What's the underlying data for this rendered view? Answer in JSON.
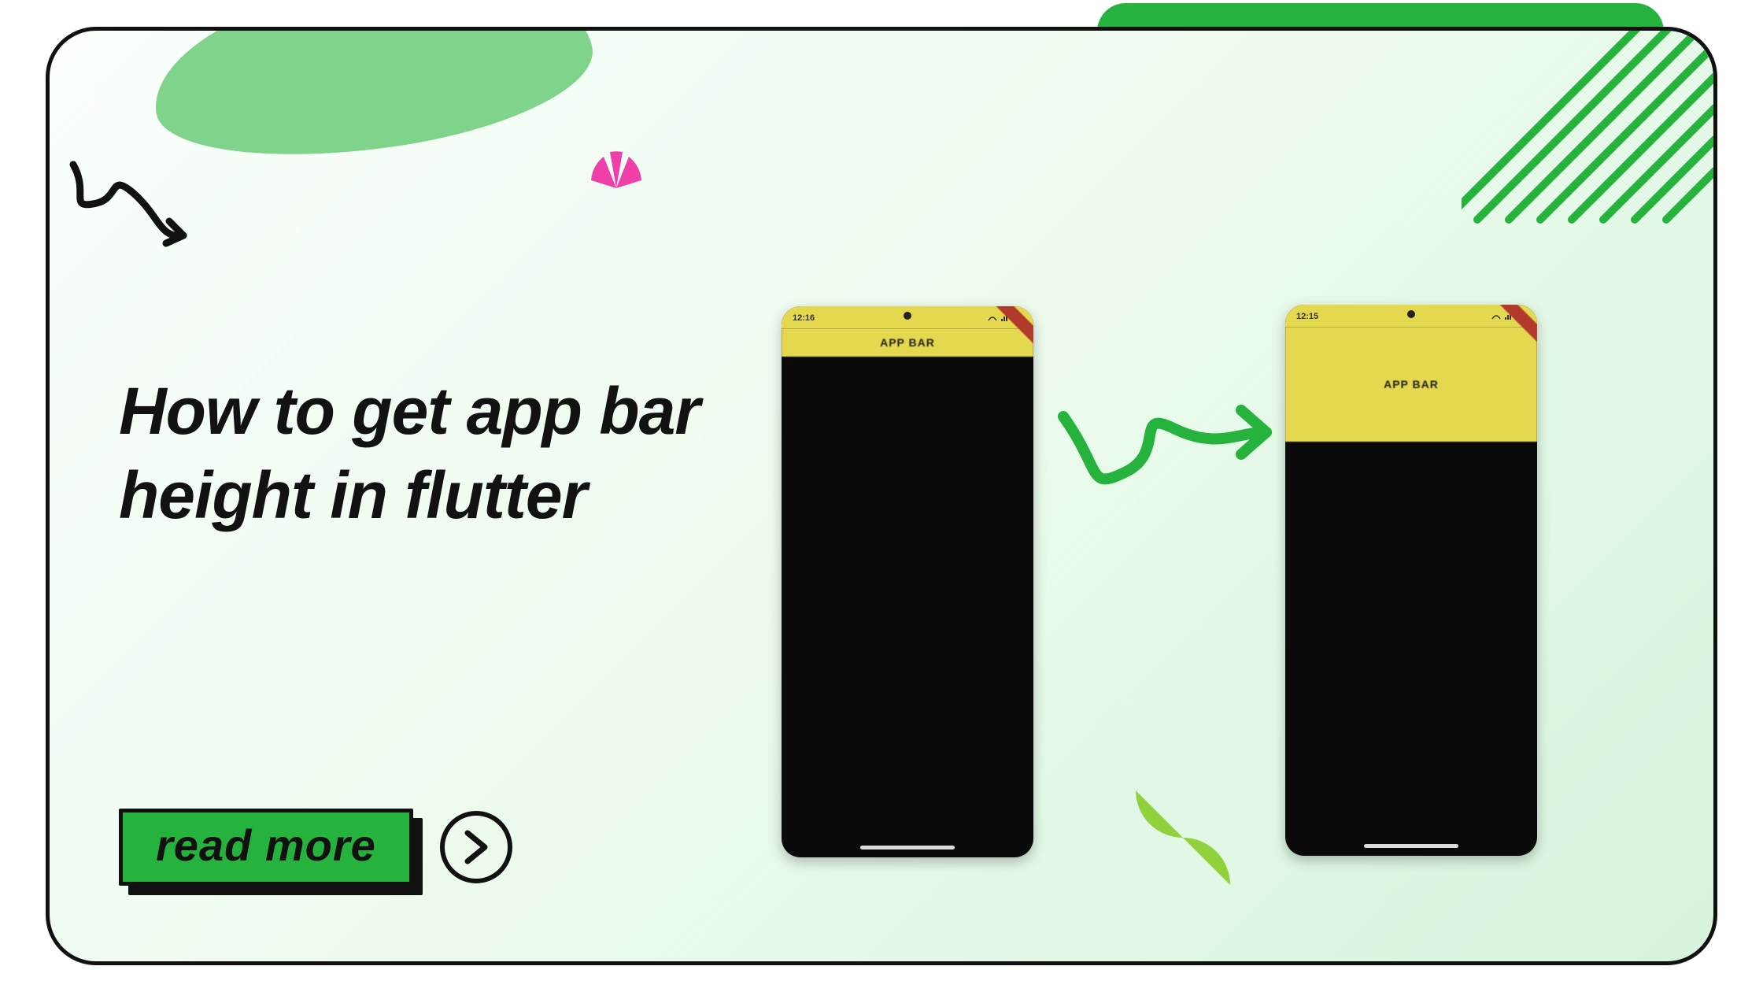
{
  "headline": "How to get app bar height in flutter",
  "cta": {
    "label": "read more"
  },
  "phones": {
    "left": {
      "status_time": "12:16",
      "appbar_label": "APP BAR"
    },
    "right": {
      "status_time": "12:15",
      "appbar_label": "APP BAR"
    }
  },
  "colors": {
    "accent_green": "#25b33e",
    "soft_green": "#7fd38a",
    "lime": "#8fd23c",
    "pink": "#ef3fa8",
    "appbar_yellow": "#e4d84f"
  }
}
